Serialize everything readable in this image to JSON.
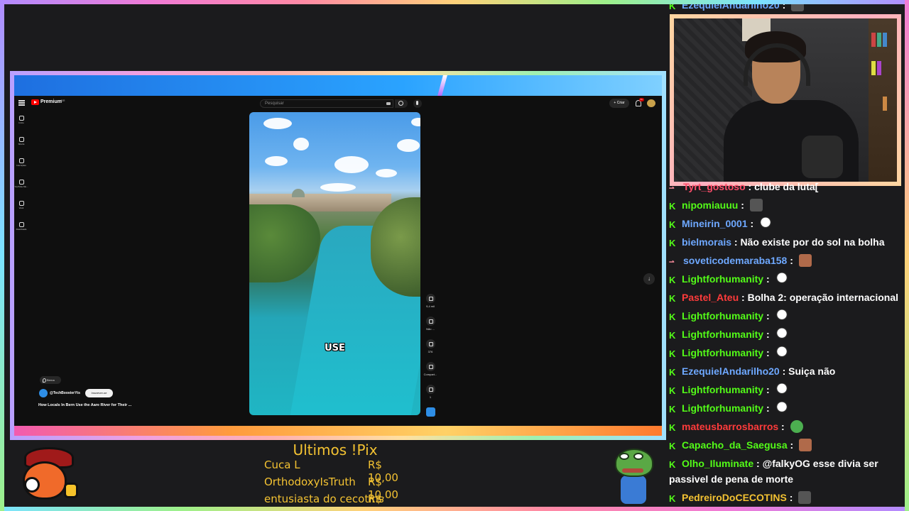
{
  "youtube": {
    "logo_text": "Premium",
    "logo_region": "BR",
    "search_placeholder": "Pesquisar",
    "create_label": "Criar",
    "notification_count": "9+",
    "sidebar": [
      {
        "label": "Início",
        "icon": "home-icon"
      },
      {
        "label": "Shorts",
        "icon": "shorts-icon"
      },
      {
        "label": "Inscrições",
        "icon": "subscriptions-icon"
      },
      {
        "label": "YouTube Mu...",
        "icon": "music-icon"
      },
      {
        "label": "Você",
        "icon": "you-icon"
      },
      {
        "label": "Downloads",
        "icon": "download-icon"
      }
    ],
    "video": {
      "caption": "USE",
      "location": "Berna",
      "channel": "@TechBoosterYts",
      "subscribe_label": "Inscrever-se",
      "title": "How Locals In Bern Use the Aare River for Their ..."
    },
    "actions": {
      "likes": "9,4 mil",
      "dislike_label": "Não ...",
      "comments": "376",
      "share_label": "Compart...",
      "remix": "1"
    }
  },
  "chat": {
    "top_partial": {
      "user": "EzequielAndarilho20",
      "color": "#6ea8ff"
    },
    "messages": [
      {
        "user": "Tyrt_gostoso",
        "color": "#ff4d6a",
        "text": "clube da luta[",
        "badge": "pix",
        "emote": null,
        "partial": true
      },
      {
        "user": "nipomiauuu",
        "color": "#53fc18",
        "text": "",
        "badge": "k",
        "emote": "gray"
      },
      {
        "user": "Mineirin_0001",
        "color": "#6ea8ff",
        "text": "",
        "badge": "k",
        "emote": "ghost"
      },
      {
        "user": "bielmorais",
        "color": "#6ea8ff",
        "text": "Não existe por do sol na bolha",
        "badge": "k",
        "emote": null
      },
      {
        "user": "soveticodemaraba158",
        "color": "#6ea8ff",
        "text": "",
        "badge": "pix",
        "emote": "face"
      },
      {
        "user": "Lightforhumanity",
        "color": "#53fc18",
        "text": "",
        "badge": "k",
        "emote": "ghost"
      },
      {
        "user": "Pastel_Ateu",
        "color": "#ff3b3b",
        "text": "Bolha 2: operação internacional",
        "badge": "k",
        "emote": null
      },
      {
        "user": "Lightforhumanity",
        "color": "#53fc18",
        "text": "",
        "badge": "k",
        "emote": "ghost"
      },
      {
        "user": "Lightforhumanity",
        "color": "#53fc18",
        "text": "",
        "badge": "k",
        "emote": "ghost"
      },
      {
        "user": "Lightforhumanity",
        "color": "#53fc18",
        "text": "",
        "badge": "k",
        "emote": "ghost"
      },
      {
        "user": "EzequielAndarilho20",
        "color": "#6ea8ff",
        "text": "Suiça não",
        "badge": "k",
        "emote": null
      },
      {
        "user": "Lightforhumanity",
        "color": "#53fc18",
        "text": "",
        "badge": "k",
        "emote": "ghost"
      },
      {
        "user": "Lightforhumanity",
        "color": "#53fc18",
        "text": "",
        "badge": "k",
        "emote": "ghost"
      },
      {
        "user": "mateusbarrosbarros",
        "color": "#ff3b3b",
        "text": "",
        "badge": "k",
        "emote": "pepe"
      },
      {
        "user": "Capacho_da_Saegusa",
        "color": "#53fc18",
        "text": "",
        "badge": "k",
        "emote": "face"
      },
      {
        "user": "Olho_Iluminate",
        "color": "#53fc18",
        "text": "@falkyOG esse divia ser",
        "text2": "passivel de pena de morte",
        "badge": "k",
        "emote": null
      },
      {
        "user": "PedreiroDoCECOTINS",
        "color": "#f3c232",
        "text": "",
        "badge": "k",
        "emote": "gray"
      }
    ]
  },
  "pix": {
    "title": "Ultimos !Pix",
    "entries": [
      {
        "name": "Cuca L",
        "amount": "R$ 10,00"
      },
      {
        "name": "OrthodoxyIsTruth",
        "amount": "R$ 10,00"
      },
      {
        "name": "entusiasta do cecotins",
        "amount": "R$ 10,00"
      }
    ]
  }
}
